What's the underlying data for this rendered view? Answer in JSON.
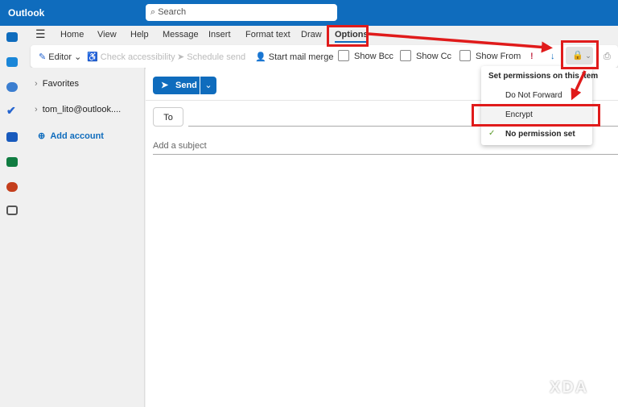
{
  "app": {
    "title": "Outlook",
    "search_placeholder": "Search"
  },
  "tabs": [
    "Home",
    "View",
    "Help",
    "Message",
    "Insert",
    "Format text",
    "Draw",
    "Options"
  ],
  "toolbar": {
    "editor": "Editor",
    "check_accessibility": "Check accessibility",
    "schedule_send": "Schedule send",
    "mail_merge": "Start mail merge",
    "show_bcc": "Show Bcc",
    "show_cc": "Show Cc",
    "show_from": "Show From"
  },
  "folders": {
    "favorites": "Favorites",
    "account": "tom_lito@outlook....",
    "add_account": "Add account"
  },
  "compose": {
    "send": "Send",
    "to": "To",
    "subject_placeholder": "Add a subject"
  },
  "permissions_menu": {
    "header": "Set permissions on this item",
    "items": [
      "Do Not Forward",
      "Encrypt",
      "No permission set"
    ],
    "checked": "No permission set"
  },
  "watermark": "XDA",
  "colors": {
    "brand": "#0f6cbd",
    "annotation": "#e01b1b"
  }
}
